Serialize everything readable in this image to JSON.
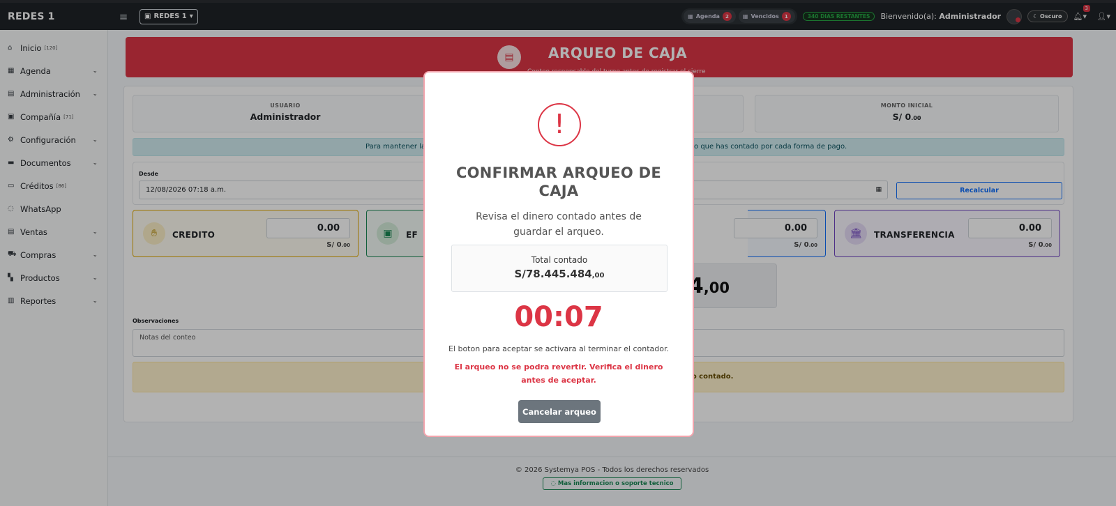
{
  "topbar": {
    "brand": "REDES 1",
    "menu_icon": "≡",
    "branch_label": "REDES 1",
    "agenda_label": "Agenda",
    "agenda_count": "2",
    "vencidos_label": "Vencidos",
    "vencidos_count": "1",
    "days_remaining": "340 DIAS RESTANTES",
    "welcome_prefix": "Bienvenido(a):",
    "welcome_user": "Administrador",
    "theme_label": "Oscuro",
    "notif_count": "3"
  },
  "sidebar": {
    "items": [
      {
        "label": "Inicio",
        "badge": "[120]",
        "icon": "home-icon"
      },
      {
        "label": "Agenda",
        "badge": "",
        "icon": "calendar-icon"
      },
      {
        "label": "Administración",
        "badge": "",
        "icon": "id-card-icon"
      },
      {
        "label": "Compañía",
        "badge": "[71]",
        "icon": "building-icon"
      },
      {
        "label": "Configuración",
        "badge": "",
        "icon": "cogs-icon"
      },
      {
        "label": "Documentos",
        "badge": "",
        "icon": "folder-icon"
      },
      {
        "label": "Créditos",
        "badge": "[86]",
        "icon": "credit-card-icon"
      },
      {
        "label": "WhatsApp",
        "badge": "",
        "icon": "whatsapp-icon"
      },
      {
        "label": "Ventas",
        "badge": "",
        "icon": "cash-register-icon"
      },
      {
        "label": "Compras",
        "badge": "",
        "icon": "cart-icon"
      },
      {
        "label": "Productos",
        "badge": "",
        "icon": "boxes-icon"
      },
      {
        "label": "Reportes",
        "badge": "",
        "icon": "chart-icon"
      }
    ]
  },
  "page": {
    "title": "ARQUEO DE CAJA",
    "subtitle": "Conteo responsable del turno antes de registrar el cierre",
    "usuario_label": "USUARIO",
    "usuario_value": "Administrador",
    "monto_label": "MONTO INICIAL",
    "monto_value": "S/ 0",
    "monto_cents": ".00",
    "info_left": "Para mantener la",
    "info_right": "te lo que has contado por cada forma de pago.",
    "desde_label": "Desde",
    "desde_value": "12/08/2026 07:18 a.m.",
    "recalc_label": "Recalcular",
    "credito_label": "CREDITO",
    "credito_amount": "0.00",
    "credito_sub": "S/ 0",
    "credito_cents": ".00",
    "efectivo_label": "EF",
    "tarjeta_amount": "0.00",
    "tarjeta_sub": "S/ 0",
    "tarjeta_cents": ".00",
    "transfer_label": "TRANSFERENCIA",
    "transfer_amount": "0.00",
    "transfer_sub": "S/ 0",
    "transfer_cents": ".00",
    "total_big": "84",
    "total_big_cents": ",00",
    "obs_label": "Observaciones",
    "obs_placeholder": "Notas del conteo",
    "warn_text": "nero contado."
  },
  "footer": {
    "copyright": "© 2026 Systemya POS - Todos los derechos reservados",
    "support": "Mas informacion o soporte tecnico"
  },
  "modal": {
    "title": "CONFIRMAR ARQUEO DE CAJA",
    "description": "Revisa el dinero contado antes de guardar el arqueo.",
    "total_label": "Total contado",
    "total_value": "S/78.445.484",
    "total_cents": ",00",
    "timer": "00:07",
    "note": "El boton para aceptar se activara al terminar el contador.",
    "warning": "El arqueo no se podra revertir. Verifica el dinero antes de aceptar.",
    "cancel_label": "Cancelar arqueo"
  },
  "colors": {
    "accent": "#dc3545",
    "credito": "#e0a800",
    "efectivo": "#198754",
    "tarjeta": "#0d6efd",
    "transferencia": "#6f42c1"
  }
}
